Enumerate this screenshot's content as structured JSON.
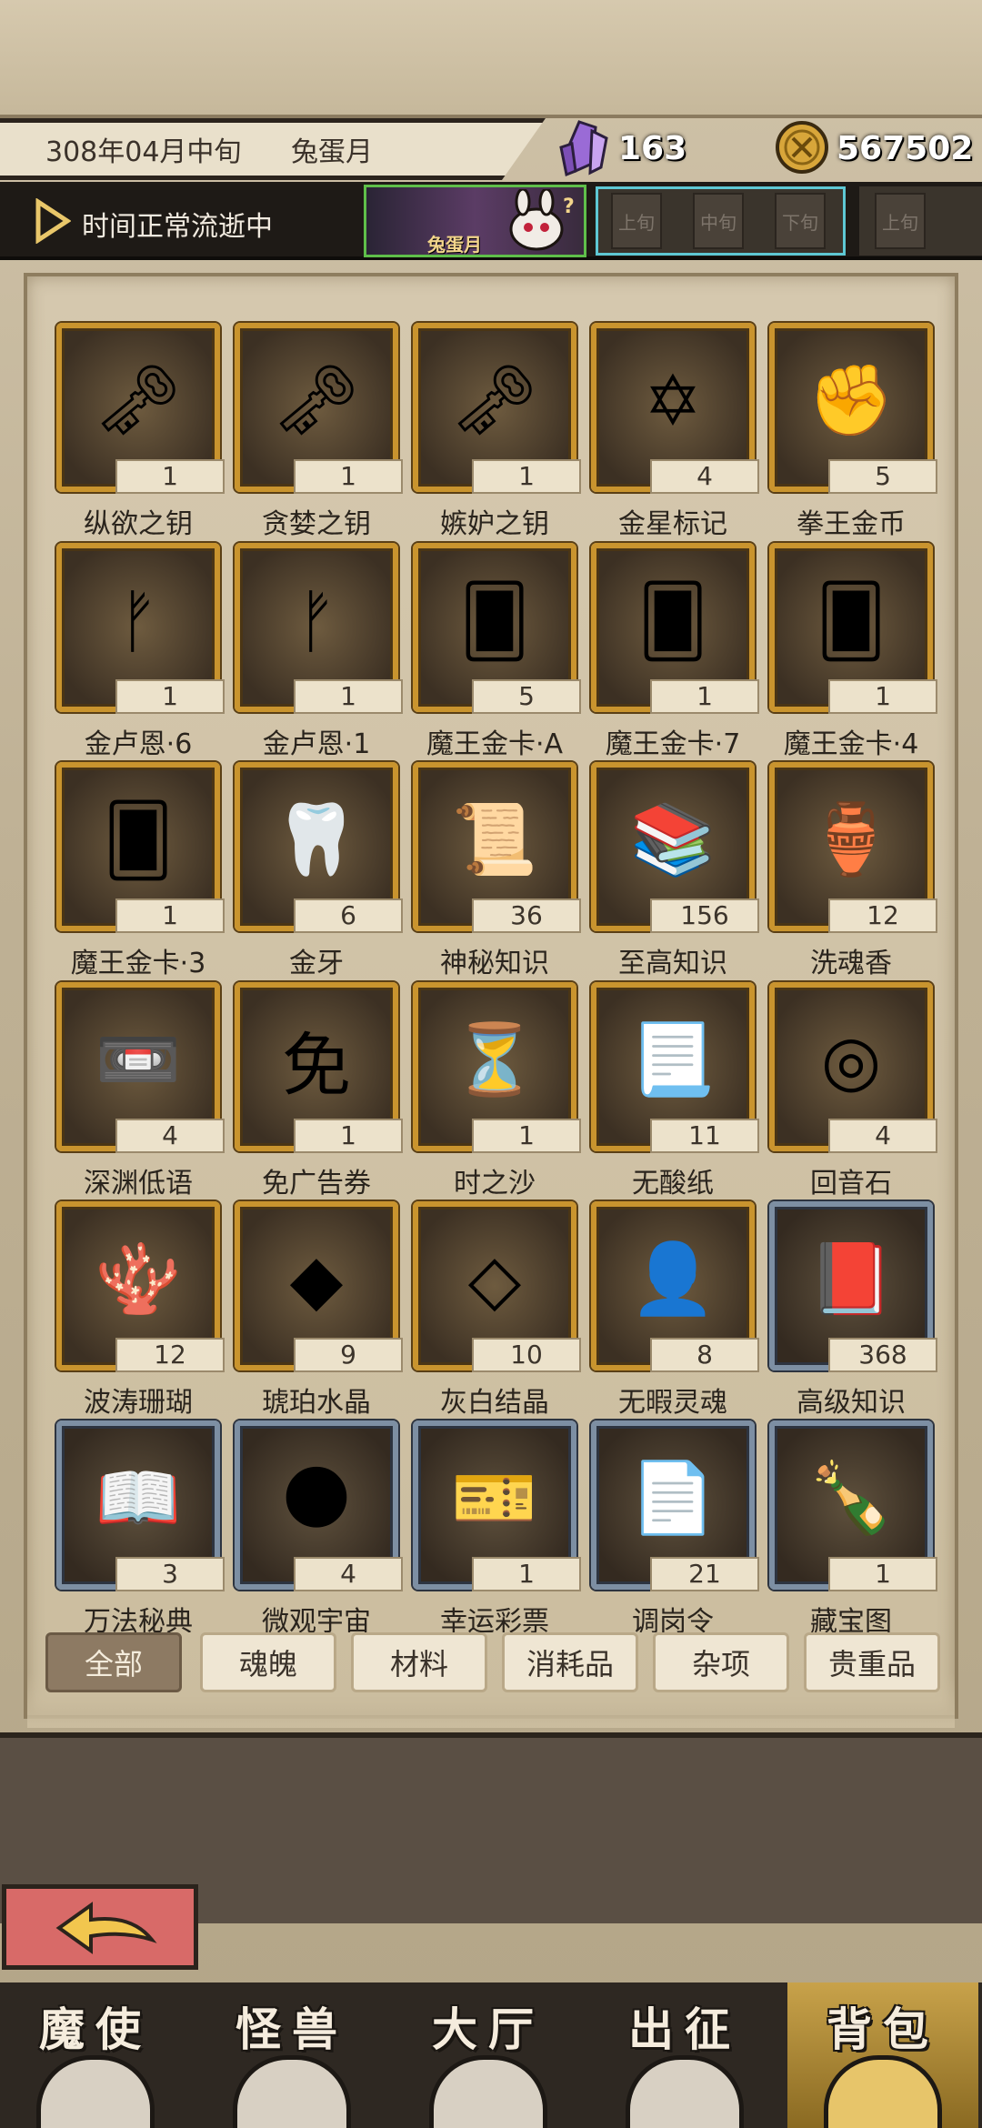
{
  "header": {
    "date": "308年04月中旬",
    "month_name": "兔蛋月",
    "crystal_count": "163",
    "coin_count": "567502",
    "time_status": "时间正常流逝中",
    "badge_label": "兔蛋月",
    "periods": [
      "上旬",
      "中旬",
      "下旬",
      "上旬"
    ]
  },
  "items": [
    {
      "name": "纵欲之钥",
      "count": "1",
      "icon": "key-heart-icon",
      "frame": "gold"
    },
    {
      "name": "贪婪之钥",
      "count": "1",
      "icon": "key-gem-icon",
      "frame": "gold"
    },
    {
      "name": "嫉妒之钥",
      "count": "1",
      "icon": "key-blue-icon",
      "frame": "gold"
    },
    {
      "name": "金星标记",
      "count": "4",
      "icon": "star-mark-icon",
      "frame": "gold"
    },
    {
      "name": "拳王金币",
      "count": "5",
      "icon": "fist-coin-icon",
      "frame": "gold"
    },
    {
      "name": "金卢恩·6",
      "count": "1",
      "icon": "rune-stone-icon",
      "frame": "gold"
    },
    {
      "name": "金卢恩·1",
      "count": "1",
      "icon": "rune-stone-icon",
      "frame": "gold"
    },
    {
      "name": "魔王金卡·A",
      "count": "5",
      "icon": "card-icon",
      "frame": "gold"
    },
    {
      "name": "魔王金卡·7",
      "count": "1",
      "icon": "card-icon",
      "frame": "gold"
    },
    {
      "name": "魔王金卡·4",
      "count": "1",
      "icon": "card-icon",
      "frame": "gold"
    },
    {
      "name": "魔王金卡·3",
      "count": "1",
      "icon": "card-icon",
      "frame": "gold"
    },
    {
      "name": "金牙",
      "count": "6",
      "icon": "tooth-icon",
      "frame": "gold"
    },
    {
      "name": "神秘知识",
      "count": "36",
      "icon": "tablet-icon",
      "frame": "gold"
    },
    {
      "name": "至高知识",
      "count": "156",
      "icon": "book-stack-icon",
      "frame": "gold"
    },
    {
      "name": "洗魂香",
      "count": "12",
      "icon": "incense-icon",
      "frame": "gold"
    },
    {
      "name": "深渊低语",
      "count": "4",
      "icon": "cassette-icon",
      "frame": "gold"
    },
    {
      "name": "免广告券",
      "count": "1",
      "icon": "ticket-icon",
      "frame": "gold"
    },
    {
      "name": "时之沙",
      "count": "1",
      "icon": "sand-icon",
      "frame": "gold"
    },
    {
      "name": "无酸纸",
      "count": "11",
      "icon": "scroll-icon",
      "frame": "gold"
    },
    {
      "name": "回音石",
      "count": "4",
      "icon": "echo-stone-icon",
      "frame": "gold"
    },
    {
      "name": "波涛珊瑚",
      "count": "12",
      "icon": "coral-icon",
      "frame": "gold"
    },
    {
      "name": "琥珀水晶",
      "count": "9",
      "icon": "amber-crystal-icon",
      "frame": "gold"
    },
    {
      "name": "灰白结晶",
      "count": "10",
      "icon": "grey-crystal-icon",
      "frame": "gold"
    },
    {
      "name": "无暇灵魂",
      "count": "8",
      "icon": "soul-icon",
      "frame": "gold"
    },
    {
      "name": "高级知识",
      "count": "368",
      "icon": "tied-book-icon",
      "frame": "steel"
    },
    {
      "name": "万法秘典",
      "count": "3",
      "icon": "spellbook-icon",
      "frame": "steel"
    },
    {
      "name": "微观宇宙",
      "count": "4",
      "icon": "planet-icon",
      "frame": "steel"
    },
    {
      "name": "幸运彩票",
      "count": "1",
      "icon": "lottery-icon",
      "frame": "steel"
    },
    {
      "name": "调岗令",
      "count": "21",
      "icon": "document-icon",
      "frame": "steel"
    },
    {
      "name": "藏宝图",
      "count": "1",
      "icon": "bottle-map-icon",
      "frame": "steel"
    },
    {
      "name": "",
      "count": "",
      "icon": "blue-orb-icon",
      "frame": "steel"
    },
    {
      "name": "",
      "count": "",
      "icon": "silhouette-icon",
      "frame": "steel"
    },
    {
      "name": "",
      "count": "",
      "icon": "rose-card-icon",
      "frame": "pink"
    },
    {
      "name": "",
      "count": "",
      "icon": "rose-card-icon",
      "frame": "pink"
    },
    {
      "name": "",
      "count": "",
      "icon": "rose-card-icon",
      "frame": "pink"
    }
  ],
  "tabs": [
    "全部",
    "魂魄",
    "材料",
    "消耗品",
    "杂项",
    "贵重品"
  ],
  "active_tab": "全部",
  "nav": [
    {
      "label": "魔使",
      "icon": "skull-icon"
    },
    {
      "label": "怪兽",
      "icon": "monster-icon"
    },
    {
      "label": "大厅",
      "icon": "hall-icon"
    },
    {
      "label": "出征",
      "icon": "warrior-icon"
    },
    {
      "label": "背包",
      "icon": "backpack-icon"
    }
  ],
  "active_nav": "背包",
  "colors": {
    "gold_frame": "#c9942e",
    "steel_frame": "#7d8fa3",
    "active_tab": "#8d7a63",
    "back_button": "#d86a68",
    "badge_border": "#5fbf4a",
    "period_border": "#5ec8d4"
  }
}
